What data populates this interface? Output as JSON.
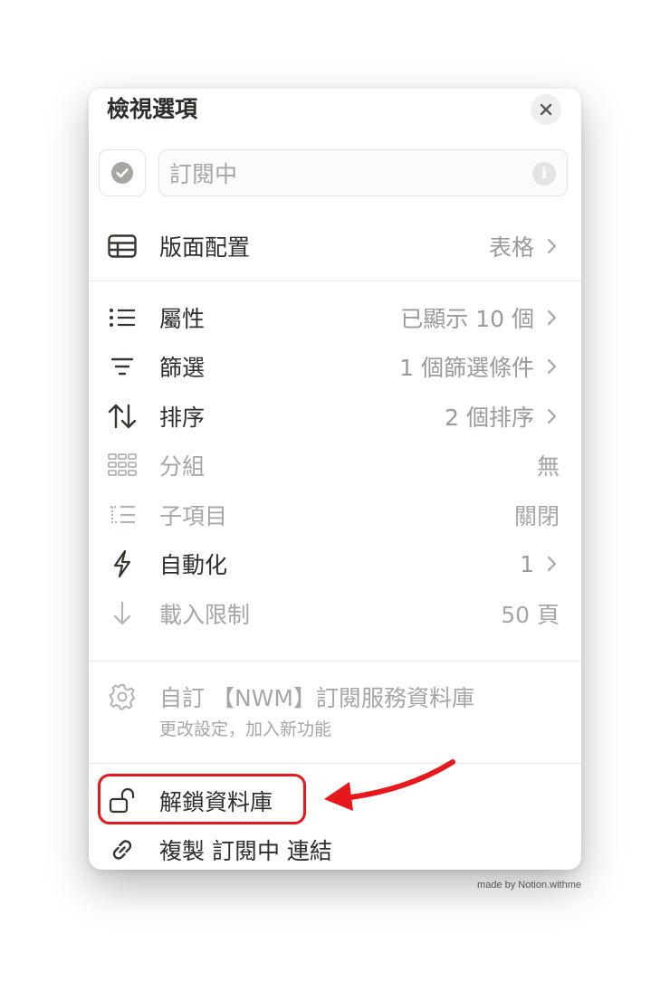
{
  "panel": {
    "title": "檢視選項",
    "name_input": {
      "value": "訂閱中"
    }
  },
  "layout_row": {
    "label": "版面配置",
    "value": "表格"
  },
  "settings": [
    {
      "key": "properties",
      "label": "屬性",
      "value": "已顯示 10 個",
      "icon": "list-icon",
      "enabled": true
    },
    {
      "key": "filter",
      "label": "篩選",
      "value": "1 個篩選條件",
      "icon": "filter-icon",
      "enabled": true
    },
    {
      "key": "sort",
      "label": "排序",
      "value": "2 個排序",
      "icon": "sort-icon",
      "enabled": true
    },
    {
      "key": "group",
      "label": "分組",
      "value": "無",
      "icon": "group-icon",
      "enabled": false
    },
    {
      "key": "subitems",
      "label": "子項目",
      "value": "關閉",
      "icon": "subitems-icon",
      "enabled": false
    },
    {
      "key": "automation",
      "label": "自動化",
      "value": "1",
      "icon": "lightning-icon",
      "enabled": true
    },
    {
      "key": "load_limit",
      "label": "載入限制",
      "value": "50 頁",
      "icon": "arrow-down-icon",
      "enabled": false
    }
  ],
  "customize": {
    "title": "自訂 【NWM】訂閱服務資料庫",
    "subtitle": "更改設定，加入新功能"
  },
  "actions": {
    "unlock": "解鎖資料庫",
    "copy_link": "複製 訂閱中 連結"
  },
  "credit": "made by Notion.withme",
  "colors": {
    "annotation": "#e8171c",
    "text_primary": "#2f2e2b",
    "text_muted": "#9b9a97",
    "text_disabled": "#a7a6a2"
  }
}
